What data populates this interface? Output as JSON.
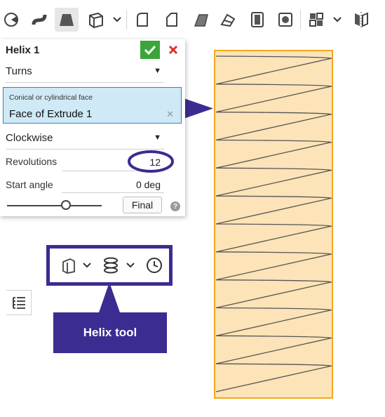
{
  "panel": {
    "title": "Helix 1",
    "mode_select": "Turns",
    "face_field": {
      "label": "Conical or cylindrical face",
      "value": "Face of Extrude 1"
    },
    "direction_select": "Clockwise",
    "revolutions": {
      "label": "Revolutions",
      "value": "12"
    },
    "start_angle": {
      "label": "Start angle",
      "value": "0 deg"
    },
    "slider_level": 0.62,
    "final_button": "Final",
    "help_glyph": "?"
  },
  "callout": {
    "label": "Helix tool"
  },
  "icons": {
    "toolbar": [
      "sketch-icon",
      "sweep-icon",
      "loft-icon",
      "extrude-icon",
      "fillet-icon",
      "chamfer-icon",
      "draft-icon",
      "shell-icon",
      "rib-icon",
      "hole-icon",
      "pattern-icon",
      "mirror-icon"
    ],
    "callout": [
      "plane-icon",
      "helix-icon",
      "history-icon"
    ]
  },
  "colors": {
    "accent_purple": "#3b2c91",
    "face_fill": "#fce3b8",
    "face_outline": "#f2a81e",
    "selected_field": "#cfe9f6",
    "ok_green": "#3aa63a",
    "cancel_red": "#e0302a"
  }
}
